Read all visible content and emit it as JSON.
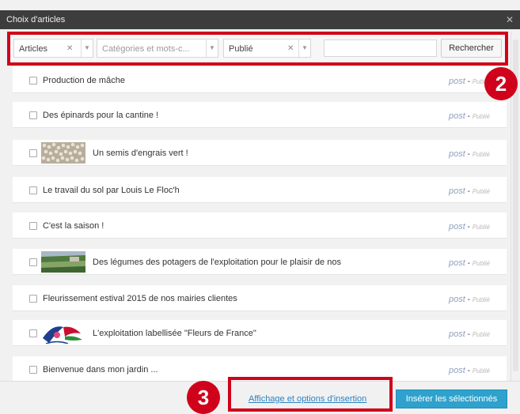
{
  "window": {
    "title": "Choix d'articles"
  },
  "filters": {
    "post_type": {
      "value": "Articles"
    },
    "taxonomy": {
      "placeholder": "Catégories et mots-c..."
    },
    "status": {
      "value": "Publié"
    },
    "search": {
      "value": "",
      "button_label": "Rechercher"
    }
  },
  "posts": [
    {
      "title": "Production de mâche",
      "type": "post",
      "status": "Publié",
      "has_thumb": false
    },
    {
      "title": "Des épinards pour la cantine !",
      "type": "post",
      "status": "Publié",
      "has_thumb": false
    },
    {
      "title": "Un semis d'engrais vert !",
      "type": "post",
      "status": "Publié",
      "has_thumb": true,
      "thumb": "seeds-thumbnail"
    },
    {
      "title": "Le travail du sol par Louis Le Floc'h",
      "type": "post",
      "status": "Publié",
      "has_thumb": false
    },
    {
      "title": "C'est la saison !",
      "type": "post",
      "status": "Publié",
      "has_thumb": false
    },
    {
      "title": "Des légumes des potagers de l'exploitation pour le plaisir de nos",
      "type": "post",
      "status": "Publié",
      "has_thumb": true,
      "thumb": "vegetable-garden-thumbnail"
    },
    {
      "title": "Fleurissement estival 2015 de nos mairies clientes",
      "type": "post",
      "status": "Publié",
      "has_thumb": false
    },
    {
      "title": "L'exploitation labellisée \"Fleurs de France\"",
      "type": "post",
      "status": "Publié",
      "has_thumb": true,
      "thumb": "fleurs-de-france-logo-thumbnail"
    },
    {
      "title": "Bienvenue dans mon jardin ...",
      "type": "post",
      "status": "Publié",
      "has_thumb": false
    }
  ],
  "footer": {
    "options_link": "Affichage et options d'insertion",
    "insert_button": "Insérer les sélectionnés"
  },
  "annotations": {
    "badge_2": "2",
    "badge_3": "3"
  },
  "colors": {
    "accent": "#2ea2cc",
    "highlight": "#d0021b",
    "titlebar": "#3d3d3d"
  }
}
